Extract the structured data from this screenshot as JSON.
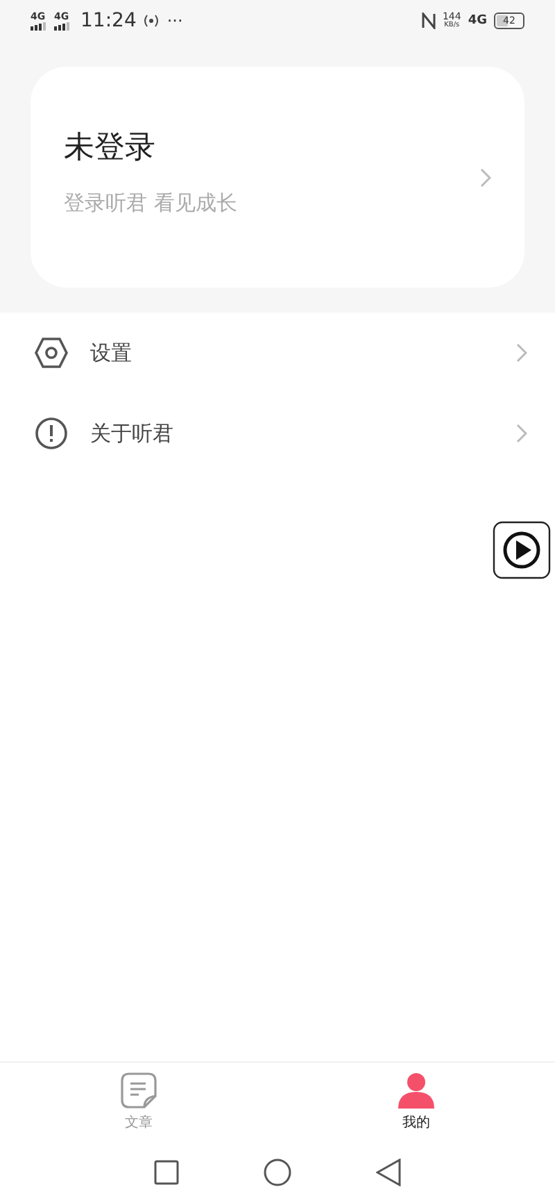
{
  "status_bar": {
    "sim_labels": [
      "4G",
      "4G"
    ],
    "time": "11:24",
    "more": "···",
    "speed": "144",
    "speed_unit": "KB/s",
    "network": "4G",
    "battery": "42"
  },
  "profile": {
    "title": "未登录",
    "subtitle": "登录听君  看见成长"
  },
  "menu": [
    {
      "kind": "settings",
      "label": "设置"
    },
    {
      "kind": "about",
      "label": "关于听君"
    }
  ],
  "tabs": [
    {
      "kind": "articles",
      "label": "文章",
      "selected": false
    },
    {
      "kind": "me",
      "label": "我的",
      "selected": true
    }
  ]
}
